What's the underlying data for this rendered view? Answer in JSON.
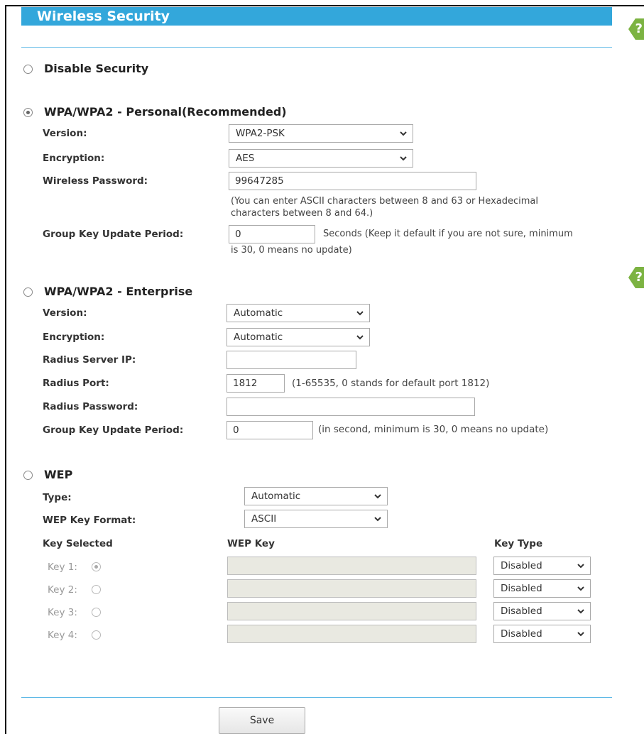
{
  "header": {
    "title": "Wireless Security",
    "help_label": "?"
  },
  "disable": {
    "label": "Disable Security",
    "selected": false
  },
  "wpa_personal": {
    "label": "WPA/WPA2 - Personal(Recommended)",
    "selected": true,
    "version_label": "Version:",
    "version_value": "WPA2-PSK",
    "encryption_label": "Encryption:",
    "encryption_value": "AES",
    "password_label": "Wireless Password:",
    "password_value": "99647285",
    "password_note_1": "(You can enter ASCII characters between 8 and 63 or Hexadecimal",
    "password_note_2": "characters between 8 and 64.)",
    "group_key_label": "Group Key Update Period:",
    "group_key_value": "0",
    "group_key_note_1": "Seconds (Keep it default if you are not sure, minimum",
    "group_key_note_2": "is 30, 0 means no update)"
  },
  "wpa_enterprise": {
    "label": "WPA/WPA2 - Enterprise",
    "selected": false,
    "version_label": "Version:",
    "version_value": "Automatic",
    "encryption_label": "Encryption:",
    "encryption_value": "Automatic",
    "radius_ip_label": "Radius Server IP:",
    "radius_ip_value": "",
    "radius_port_label": "Radius Port:",
    "radius_port_value": "1812",
    "radius_port_note": "(1-65535, 0 stands for default port 1812)",
    "radius_password_label": "Radius Password:",
    "radius_password_value": "",
    "group_key_label": "Group Key Update Period:",
    "group_key_value": "0",
    "group_key_note": "(in second, minimum is 30, 0 means no update)"
  },
  "wep": {
    "label": "WEP",
    "selected": false,
    "type_label": "Type:",
    "type_value": "Automatic",
    "format_label": "WEP Key Format:",
    "format_value": "ASCII",
    "col_key_selected": "Key Selected",
    "col_wep_key": "WEP Key",
    "col_key_type": "Key Type",
    "keys": [
      {
        "label": "Key 1:",
        "selected": true,
        "value": "",
        "type": "Disabled"
      },
      {
        "label": "Key 2:",
        "selected": false,
        "value": "",
        "type": "Disabled"
      },
      {
        "label": "Key 3:",
        "selected": false,
        "value": "",
        "type": "Disabled"
      },
      {
        "label": "Key 4:",
        "selected": false,
        "value": "",
        "type": "Disabled"
      }
    ]
  },
  "footer": {
    "save_label": "Save"
  },
  "colors": {
    "accent": "#33a7db",
    "help": "#7cb342"
  }
}
